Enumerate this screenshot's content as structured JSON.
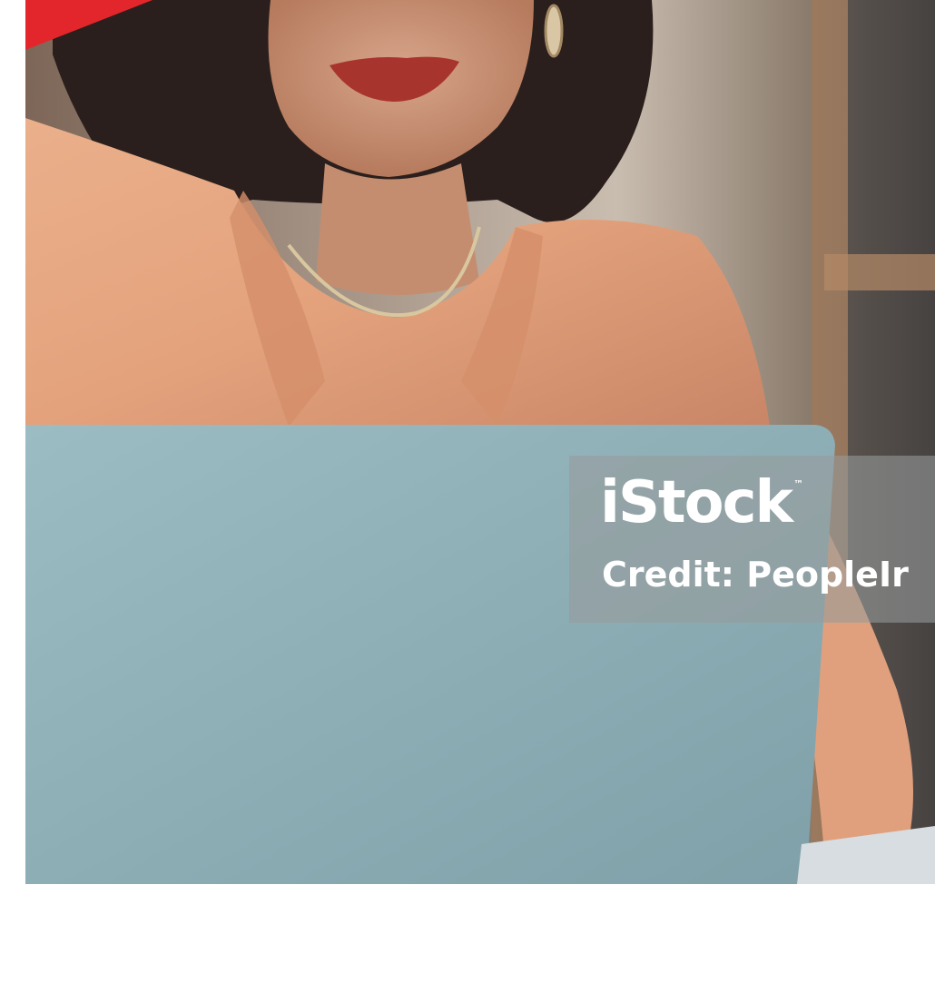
{
  "watermark": {
    "logo_text": "iStock",
    "trademark": "™",
    "credit_text": "Credit: PeopleIr"
  },
  "colors": {
    "accent_red": "#e2262b",
    "laptop_blue": "#8fb0b8",
    "shirt_peach": "#e7a883"
  }
}
